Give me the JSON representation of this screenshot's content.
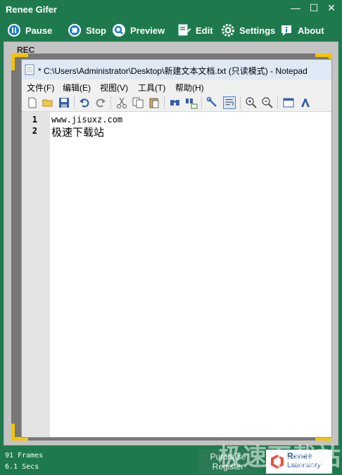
{
  "app": {
    "title": "Renee Gifer",
    "window_controls": {
      "minimize": "—",
      "maximize": "☐",
      "close": "✕"
    }
  },
  "toolbar": {
    "pause": "Pause",
    "stop": "Stop",
    "preview": "Preview",
    "edit": "Edit",
    "settings": "Settings",
    "about": "About"
  },
  "capture": {
    "rec_label": "REC"
  },
  "notepad": {
    "title": "* C:\\Users\\Administrator\\Desktop\\新建文本文档.txt (只读模式) - Notepad",
    "menu": [
      "文件(F)",
      "编辑(E)",
      "视图(V)",
      "工具(T)",
      "帮助(H)"
    ],
    "tool_icons": [
      "new-file-icon",
      "open-folder-icon",
      "save-icon",
      "undo-icon",
      "redo-icon",
      "cut-icon",
      "copy-icon",
      "paste-icon",
      "find-icon",
      "replace-icon",
      "wrench-icon",
      "word-wrap-icon",
      "zoom-in-icon",
      "zoom-out-icon",
      "view-icon",
      "font-icon"
    ],
    "lines": [
      {
        "num": "1",
        "text": "www.jisuxz.com"
      },
      {
        "num": "2",
        "text": "极速下载站"
      }
    ]
  },
  "status": {
    "frames": "91 Frames",
    "secs": "6.1 Secs",
    "purchase_line1": "Purchase",
    "purchase_line2": "Register",
    "brand_line1": "Renee",
    "brand_line2": "Laboratory"
  },
  "watermark": "极速下载站",
  "colors": {
    "brand_green": "#1e7a4d",
    "frame_yellow": "#f5c400",
    "button_green": "#2c7a55"
  }
}
